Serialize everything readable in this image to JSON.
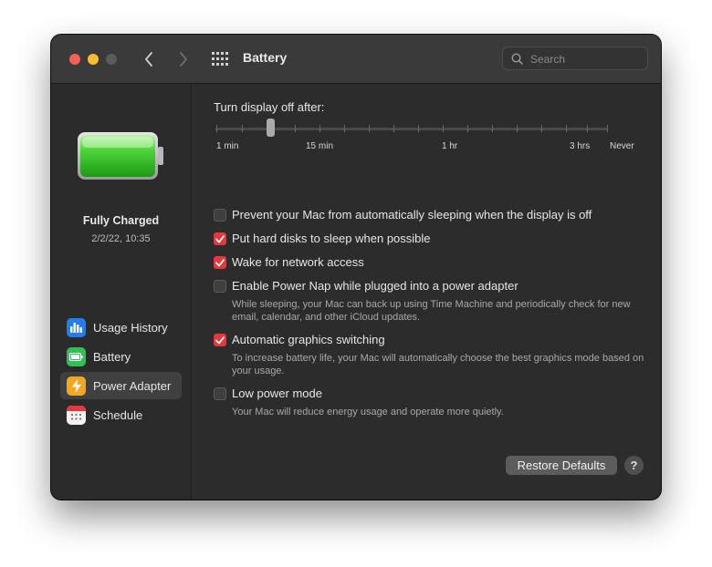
{
  "window": {
    "title": "Battery"
  },
  "search": {
    "placeholder": "Search"
  },
  "status": {
    "title": "Fully Charged",
    "timestamp": "2/2/22, 10:35",
    "battery_level": 1.0,
    "battery_color": "#34c84a"
  },
  "sidebar": {
    "items": [
      {
        "label": "Usage History",
        "icon": "bar-chart-icon",
        "color": "#1f7ff0",
        "selected": false
      },
      {
        "label": "Battery",
        "icon": "battery-icon",
        "color": "#30c156",
        "selected": false
      },
      {
        "label": "Power Adapter",
        "icon": "lightning-icon",
        "color": "#f5a623",
        "selected": true
      },
      {
        "label": "Schedule",
        "icon": "calendar-icon",
        "color": "#f2f2f2",
        "selected": false
      }
    ]
  },
  "display_sleep": {
    "label": "Turn display off after:",
    "ticks": [
      "1 min",
      "15 min",
      "1 hr",
      "3 hrs",
      "Never"
    ],
    "selected_tick_fraction": 0.14
  },
  "options": [
    {
      "label": "Prevent your Mac from automatically sleeping when the display is off",
      "checked": false,
      "description": ""
    },
    {
      "label": "Put hard disks to sleep when possible",
      "checked": true,
      "description": ""
    },
    {
      "label": "Wake for network access",
      "checked": true,
      "description": ""
    },
    {
      "label": "Enable Power Nap while plugged into a power adapter",
      "checked": false,
      "description": "While sleeping, your Mac can back up using Time Machine and periodically check for new email, calendar, and other iCloud updates."
    },
    {
      "label": "Automatic graphics switching",
      "checked": true,
      "description": "To increase battery life, your Mac will automatically choose the best graphics mode based on your usage."
    },
    {
      "label": "Low power mode",
      "checked": false,
      "description": "Your Mac will reduce energy usage and operate more quietly."
    }
  ],
  "buttons": {
    "restore_defaults": "Restore Defaults",
    "help": "?"
  },
  "colors": {
    "accent_checkbox": "#e5383b",
    "window_bg": "#2c2c2c"
  }
}
